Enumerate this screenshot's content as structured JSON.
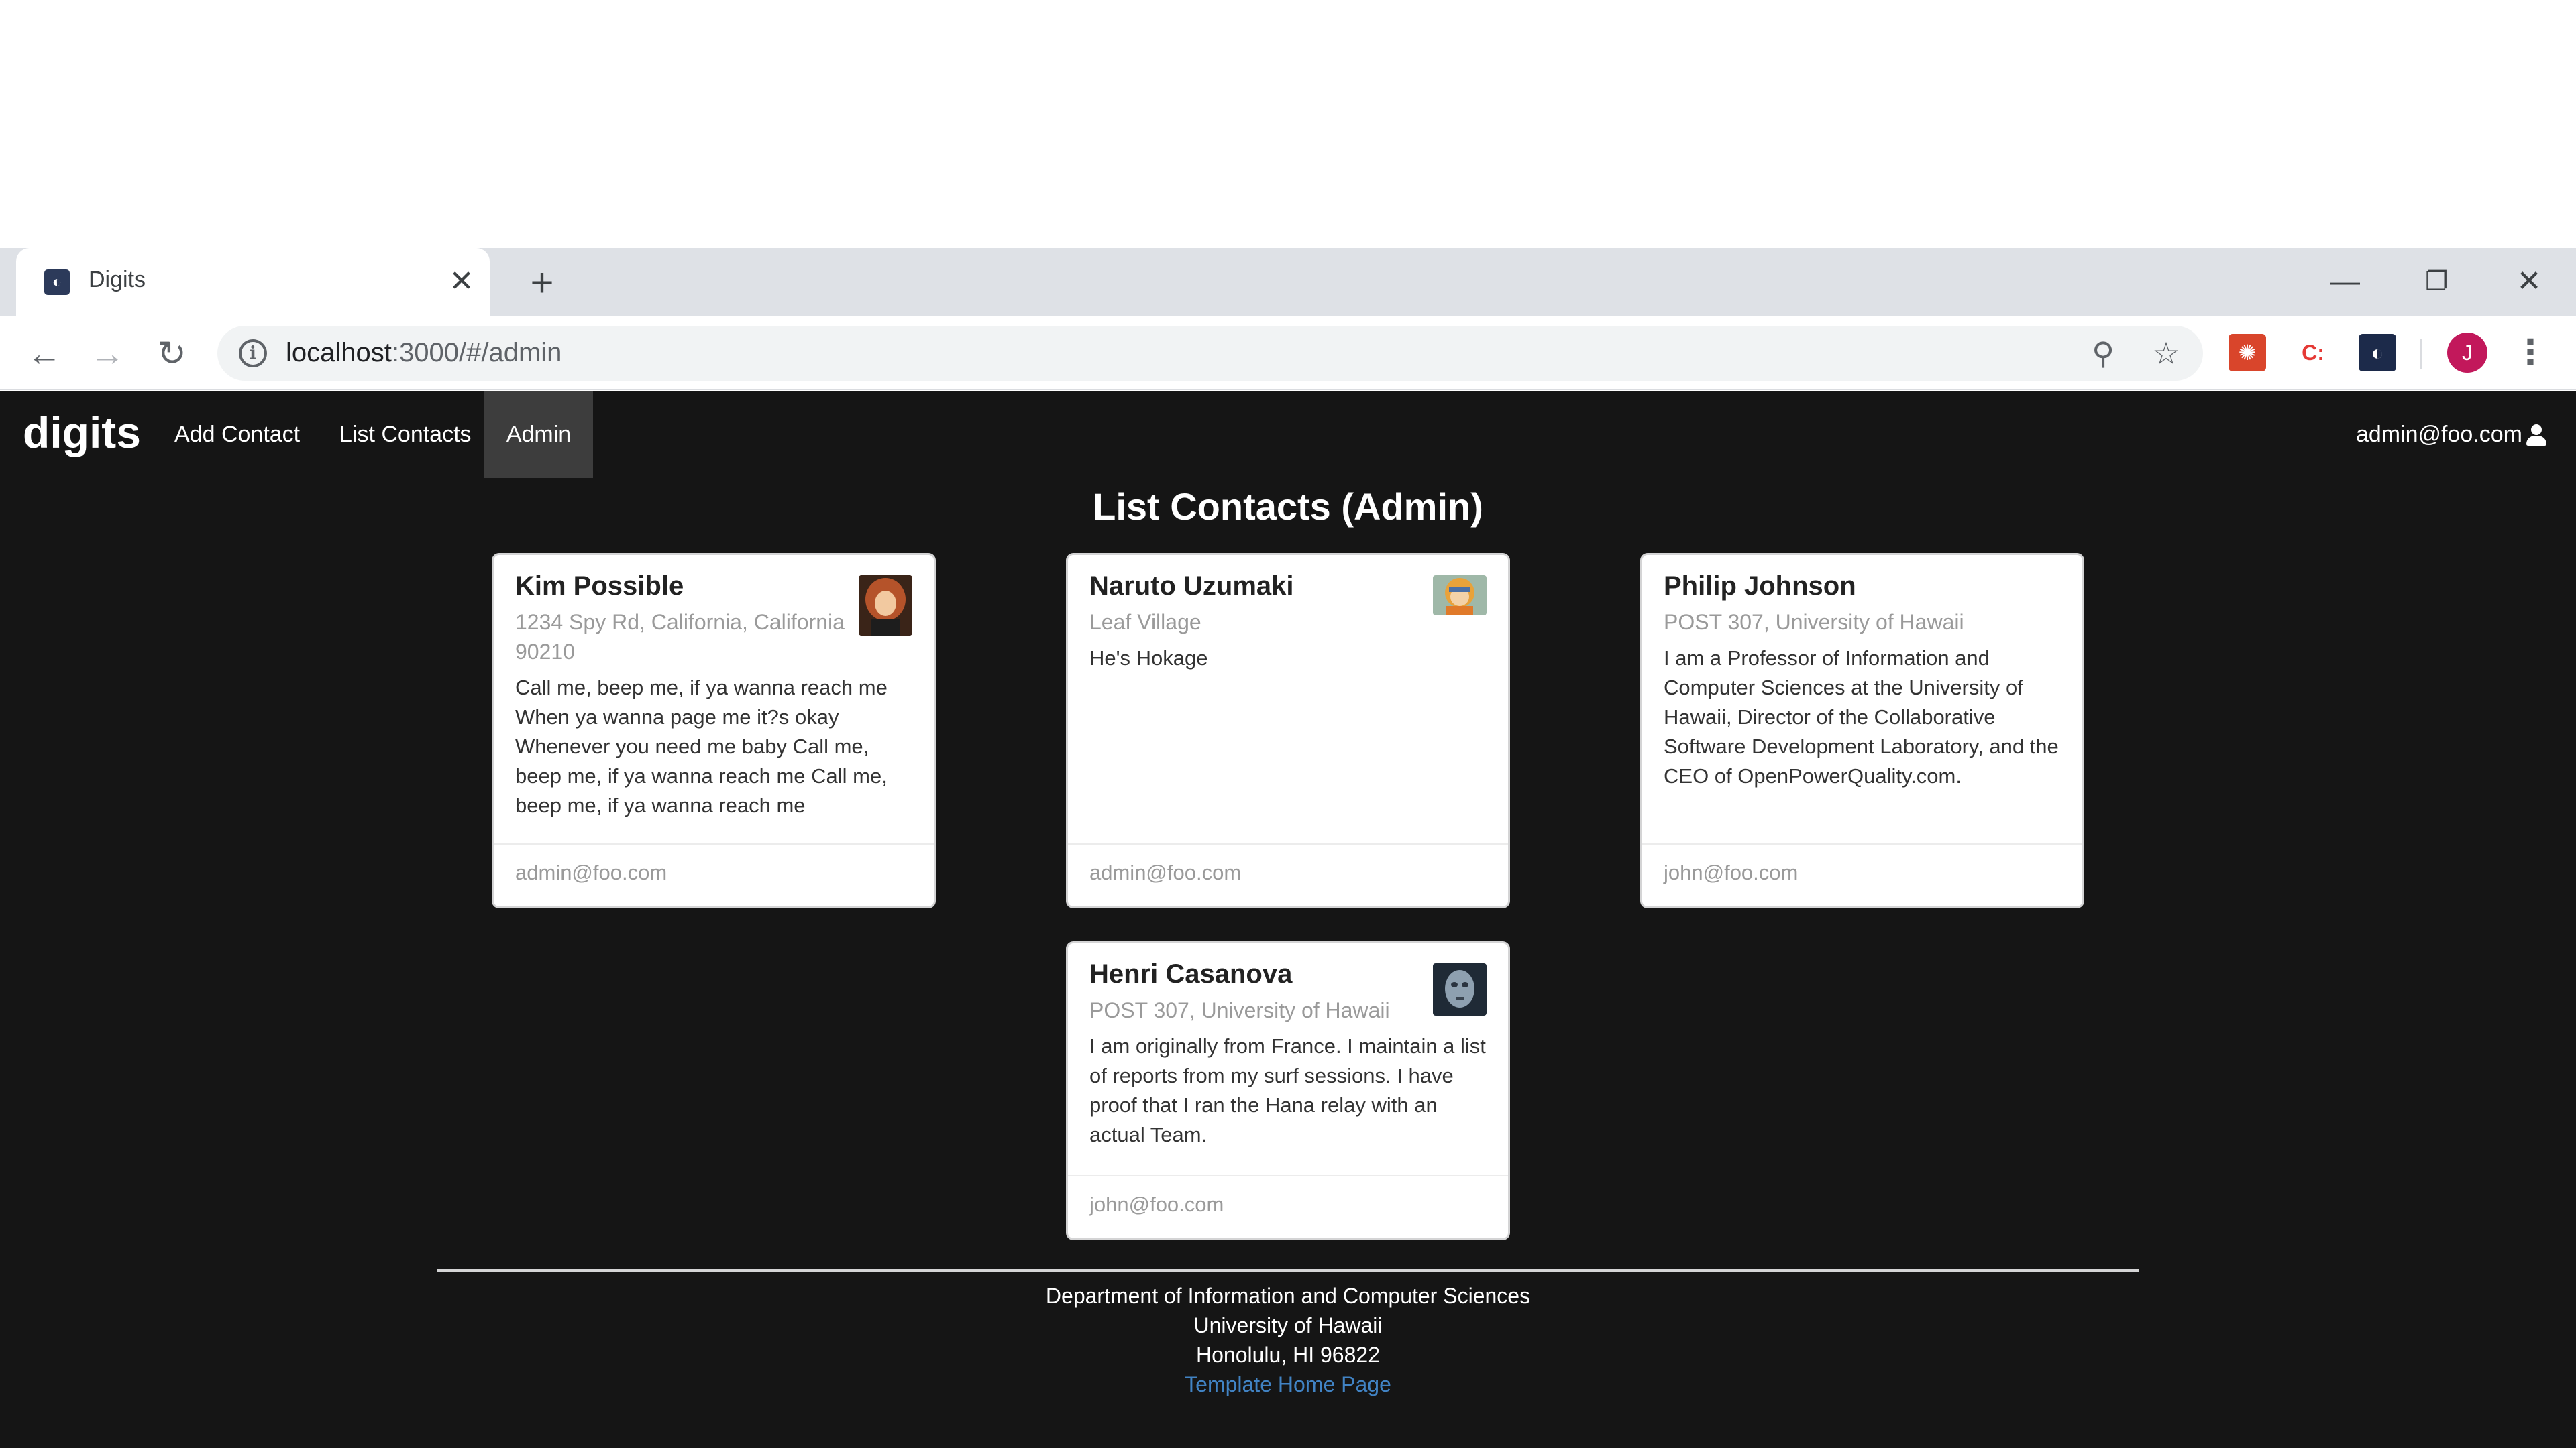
{
  "browser": {
    "tab_title": "Digits",
    "tab_close": "✕",
    "new_tab": "+",
    "url_host": "localhost",
    "url_rest": ":3000/#/admin",
    "avatar_letter": "J",
    "ext_badge": "C:"
  },
  "navbar": {
    "brand": "digits",
    "items": [
      {
        "label": "Add Contact"
      },
      {
        "label": "List Contacts"
      },
      {
        "label": "Admin"
      }
    ],
    "user": "admin@foo.com"
  },
  "main": {
    "title": "List Contacts (Admin)",
    "contacts": [
      {
        "name": "Kim Possible",
        "address": "1234 Spy Rd, California, California 90210",
        "description": "Call me, beep me, if ya wanna reach me When ya wanna page me it?s okay Whenever you need me baby Call me, beep me, if ya wanna reach me Call me, beep me, if ya wanna reach me",
        "owner": "admin@foo.com",
        "avatar_color": "#b5532a"
      },
      {
        "name": "Naruto Uzumaki",
        "address": "Leaf Village",
        "description": "He's Hokage",
        "owner": "admin@foo.com",
        "avatar_color": "#e8a23a"
      },
      {
        "name": "Philip Johnson",
        "address": "POST 307, University of Hawaii",
        "description": "I am a Professor of Information and Computer Sciences at the University of Hawaii, Director of the Collaborative Software Development Laboratory, and the CEO of OpenPowerQuality.com.",
        "owner": "john@foo.com"
      },
      {
        "name": "Henri Casanova",
        "address": "POST 307, University of Hawaii",
        "description": "I am originally from France. I maintain a list of reports from my surf sessions. I have proof that I ran the Hana relay with an actual Team.",
        "owner": "john@foo.com",
        "avatar_color": "#4a5a6a"
      }
    ]
  },
  "footer": {
    "line1": "Department of Information and Computer Sciences",
    "line2": "University of Hawaii",
    "line3": "Honolulu, HI 96822",
    "link": "Template Home Page"
  }
}
